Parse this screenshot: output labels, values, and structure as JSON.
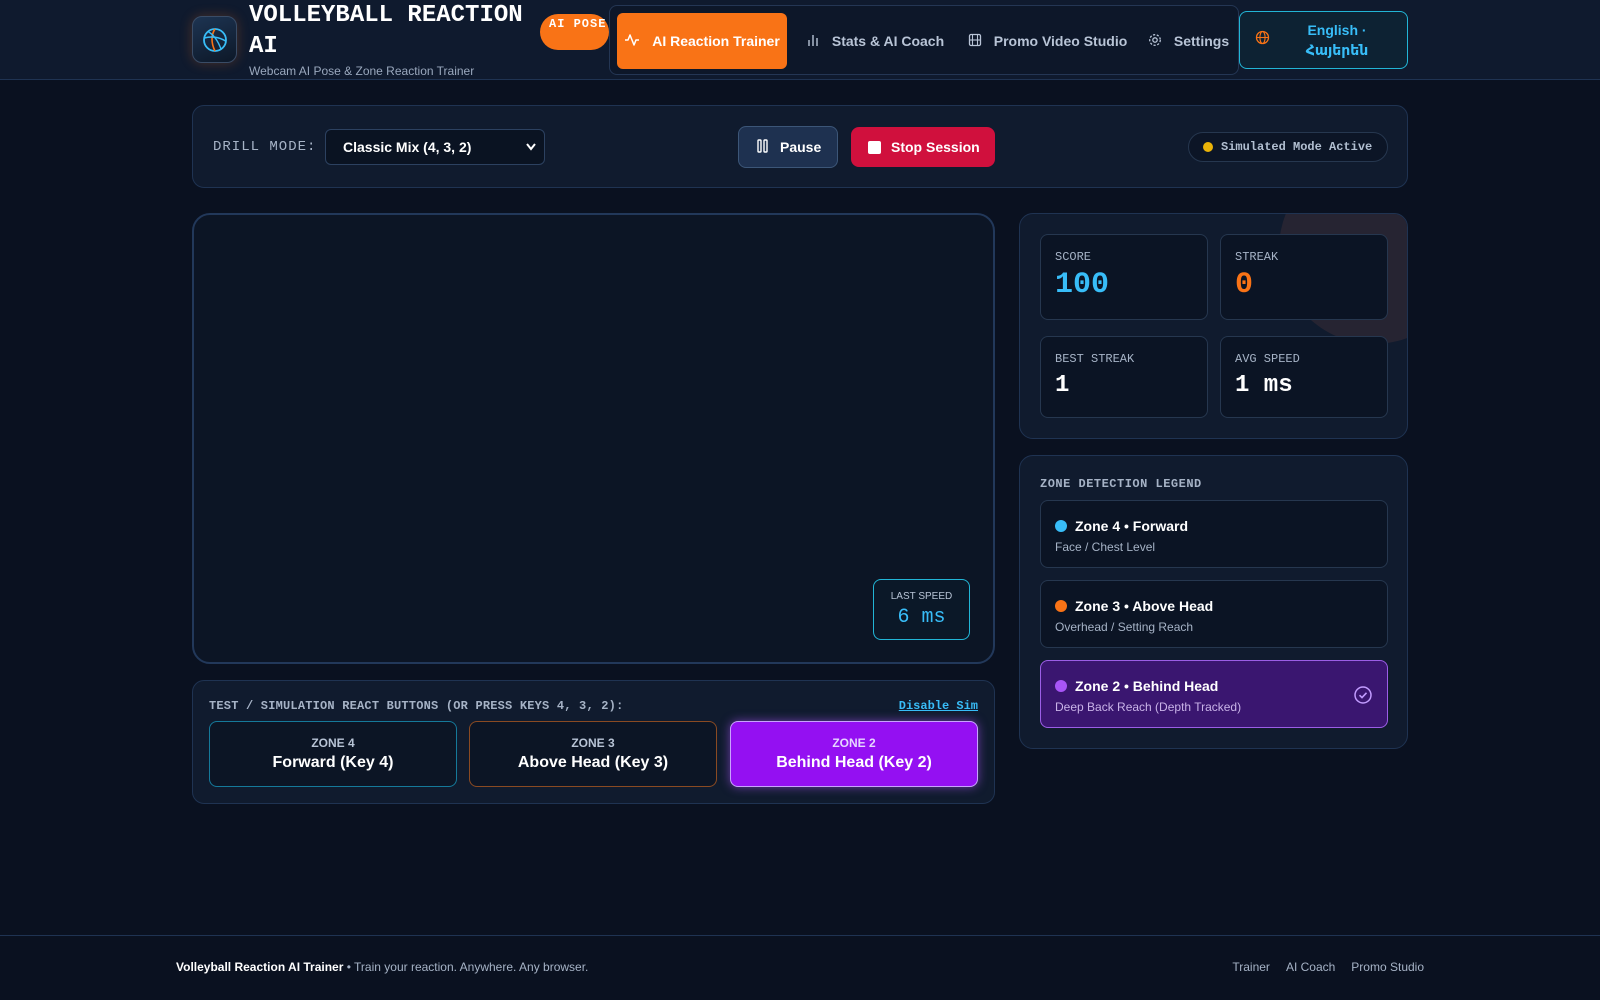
{
  "header": {
    "title": "VOLLEYBALL REACTION AI",
    "subtitle": "Webcam AI Pose & Zone Reaction Trainer",
    "badge": "AI POSE",
    "nav": [
      {
        "label": "AI Reaction Trainer",
        "icon": "activity-icon",
        "active": true
      },
      {
        "label": "Stats & AI Coach",
        "icon": "bar-chart-icon",
        "active": false
      },
      {
        "label": "Promo Video Studio",
        "icon": "film-icon",
        "active": false
      },
      {
        "label": "Settings",
        "icon": "gear-icon",
        "active": false
      }
    ],
    "language": "English · Հայերեն"
  },
  "controls": {
    "drill_label": "DRILL MODE:",
    "drill_value": "Classic Mix (4, 3, 2)",
    "pause_label": "Pause",
    "stop_label": "Stop Session",
    "sim_status": "Simulated Mode Active"
  },
  "video": {
    "last_speed_label": "LAST SPEED",
    "last_speed_value": "6 ms"
  },
  "sim": {
    "title": "TEST / SIMULATION REACT BUTTONS (OR PRESS KEYS 4, 3, 2):",
    "disable_label": "Disable Sim",
    "buttons": [
      {
        "zone": "ZONE 4",
        "label": "Forward (Key 4)"
      },
      {
        "zone": "ZONE 3",
        "label": "Above Head (Key 3)"
      },
      {
        "zone": "ZONE 2",
        "label": "Behind Head (Key 2)"
      }
    ]
  },
  "stats": {
    "score_label": "SCORE",
    "score": "100",
    "streak_label": "STREAK",
    "streak": "0",
    "best_label": "BEST STREAK",
    "best": "1",
    "avg_label": "AVG SPEED",
    "avg": "1 ms"
  },
  "legend": {
    "title": "ZONE DETECTION LEGEND",
    "items": [
      {
        "name": "Zone 4 • Forward",
        "desc": "Face / Chest Level",
        "color": "#38bdf8"
      },
      {
        "name": "Zone 3 • Above Head",
        "desc": "Overhead / Setting Reach",
        "color": "#f97316"
      },
      {
        "name": "Zone 2 • Behind Head",
        "desc": "Deep Back Reach (Depth Tracked)",
        "color": "#a855f7"
      }
    ]
  },
  "footer": {
    "brand": "Volleyball Reaction AI Trainer",
    "tagline": " • Train your reaction. Anywhere. Any browser.",
    "links": [
      "Trainer",
      "AI Coach",
      "Promo Studio"
    ]
  },
  "colors": {
    "accent": "#f97316",
    "cyan": "#38bdf8",
    "purple": "#a855f7",
    "danger": "#d0103d"
  }
}
